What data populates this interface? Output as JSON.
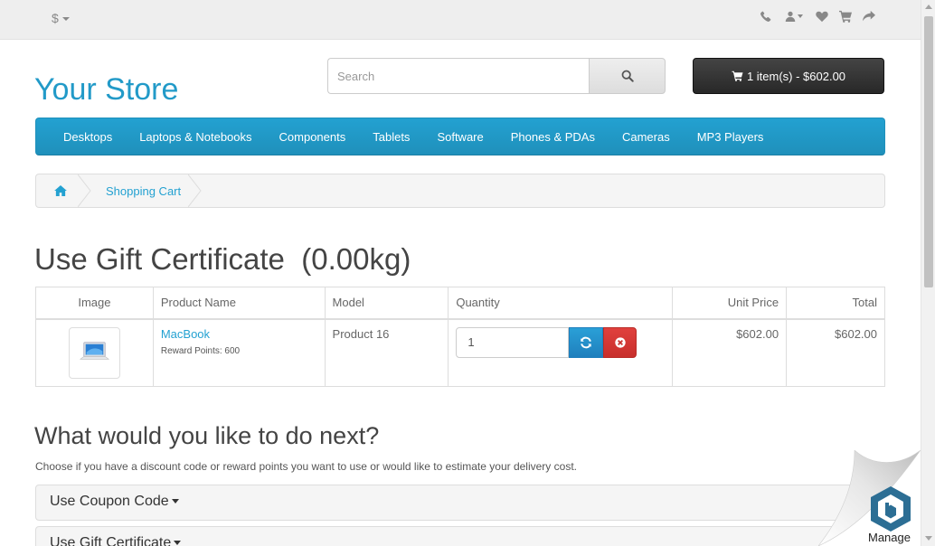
{
  "top_bar": {
    "currency": "$",
    "links": [
      "phone-icon",
      "user-icon",
      "heart-icon",
      "cart-icon",
      "share-icon"
    ]
  },
  "header": {
    "logo": "Your Store",
    "search_placeholder": "Search",
    "cart_button": "1 item(s) - $602.00"
  },
  "menu": {
    "items": [
      "Desktops",
      "Laptops & Notebooks",
      "Components",
      "Tablets",
      "Software",
      "Phones & PDAs",
      "Cameras",
      "MP3 Players"
    ]
  },
  "breadcrumb": {
    "home_icon": "home-icon",
    "current": "Shopping Cart"
  },
  "page_title": "Use Gift Certificate  (0.00kg)",
  "cart_table": {
    "headers": {
      "image": "Image",
      "name": "Product Name",
      "model": "Model",
      "quantity": "Quantity",
      "unit_price": "Unit Price",
      "total": "Total"
    },
    "rows": [
      {
        "name": "MacBook",
        "reward": "Reward Points: 600",
        "model": "Product 16",
        "quantity": "1",
        "unit_price": "$602.00",
        "total": "$602.00"
      }
    ]
  },
  "next": {
    "title": "What would you like to do next?",
    "description": "Choose if you have a discount code or reward points you want to use or would like to estimate your delivery cost.",
    "panels": [
      "Use Coupon Code",
      "Use Gift Certificate"
    ]
  },
  "manage_widget": {
    "label": "Manage"
  },
  "colors": {
    "accent": "#229ac8",
    "menu": "#229ac8",
    "cart_button": "#363636",
    "update": "#1f90c9",
    "remove": "#d43f3a"
  }
}
